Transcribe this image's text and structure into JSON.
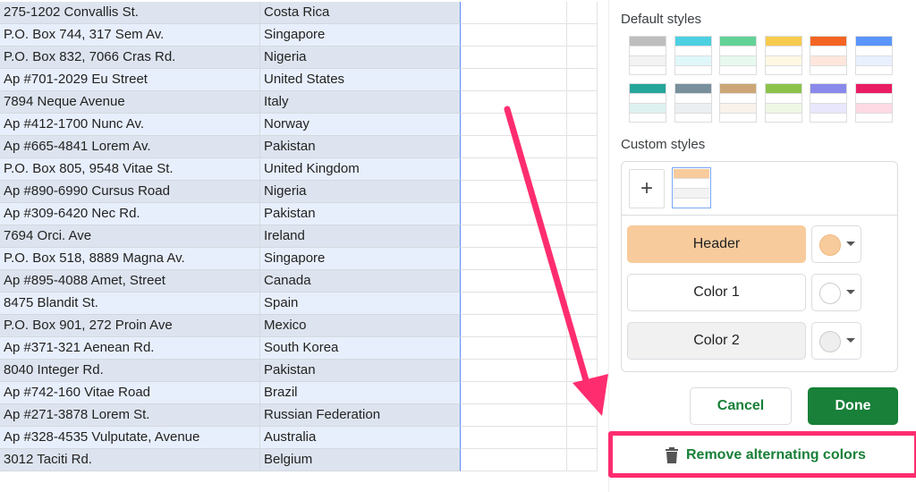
{
  "rows": [
    [
      "275-1202 Convallis St.",
      "Costa Rica"
    ],
    [
      "P.O. Box 744, 317 Sem Av.",
      "Singapore"
    ],
    [
      "P.O. Box 832, 7066 Cras Rd.",
      "Nigeria"
    ],
    [
      "Ap #701-2029 Eu Street",
      "United States"
    ],
    [
      "7894 Neque Avenue",
      "Italy"
    ],
    [
      "Ap #412-1700 Nunc Av.",
      "Norway"
    ],
    [
      "Ap #665-4841 Lorem Av.",
      "Pakistan"
    ],
    [
      "P.O. Box 805, 9548 Vitae St.",
      "United Kingdom"
    ],
    [
      "Ap #890-6990 Cursus Road",
      "Nigeria"
    ],
    [
      "Ap #309-6420 Nec Rd.",
      "Pakistan"
    ],
    [
      "7694 Orci. Ave",
      "Ireland"
    ],
    [
      "P.O. Box 518, 8889 Magna Av.",
      "Singapore"
    ],
    [
      "Ap #895-4088 Amet, Street",
      "Canada"
    ],
    [
      "8475 Blandit St.",
      "Spain"
    ],
    [
      "P.O. Box 901, 272 Proin Ave",
      "Mexico"
    ],
    [
      "Ap #371-321 Aenean Rd.",
      "South Korea"
    ],
    [
      "8040 Integer Rd.",
      "Pakistan"
    ],
    [
      "Ap #742-160 Vitae Road",
      "Brazil"
    ],
    [
      "Ap #271-3878 Lorem St.",
      "Russian Federation"
    ],
    [
      "Ap #328-4535 Vulputate, Avenue",
      "Australia"
    ],
    [
      "3012 Taciti Rd.",
      "Belgium"
    ]
  ],
  "panel": {
    "default_styles_label": "Default styles",
    "default_styles": [
      [
        "#bdbdbd",
        "#f3f3f3"
      ],
      [
        "#4dd0e1",
        "#e0f7fa"
      ],
      [
        "#63d297",
        "#e7f9ef"
      ],
      [
        "#f7cb4d",
        "#fef8e3"
      ],
      [
        "#f46524",
        "#ffe6dd"
      ],
      [
        "#5b95f9",
        "#e8f0fe"
      ],
      [
        "#26a69a",
        "#ddf2f0"
      ],
      [
        "#78909c",
        "#ebeff1"
      ],
      [
        "#cca677",
        "#f8f2eb"
      ],
      [
        "#8bc34a",
        "#eef7e3"
      ],
      [
        "#8989eb",
        "#e8e7fc"
      ],
      [
        "#e91d63",
        "#fdd9e4"
      ]
    ],
    "custom_styles_label": "Custom styles",
    "add_icon": "+",
    "custom_style": [
      "#f8cb9c",
      "#f3f3f3"
    ],
    "header_label": "Header",
    "header_color": "#f8cb9c",
    "color1_label": "Color 1",
    "color1": "#ffffff",
    "color2_label": "Color 2",
    "color2": "#f3f3f3",
    "cancel_label": "Cancel",
    "done_label": "Done",
    "remove_label": "Remove alternating colors",
    "accent": "#188038",
    "highlight": "#ff2d6f"
  }
}
